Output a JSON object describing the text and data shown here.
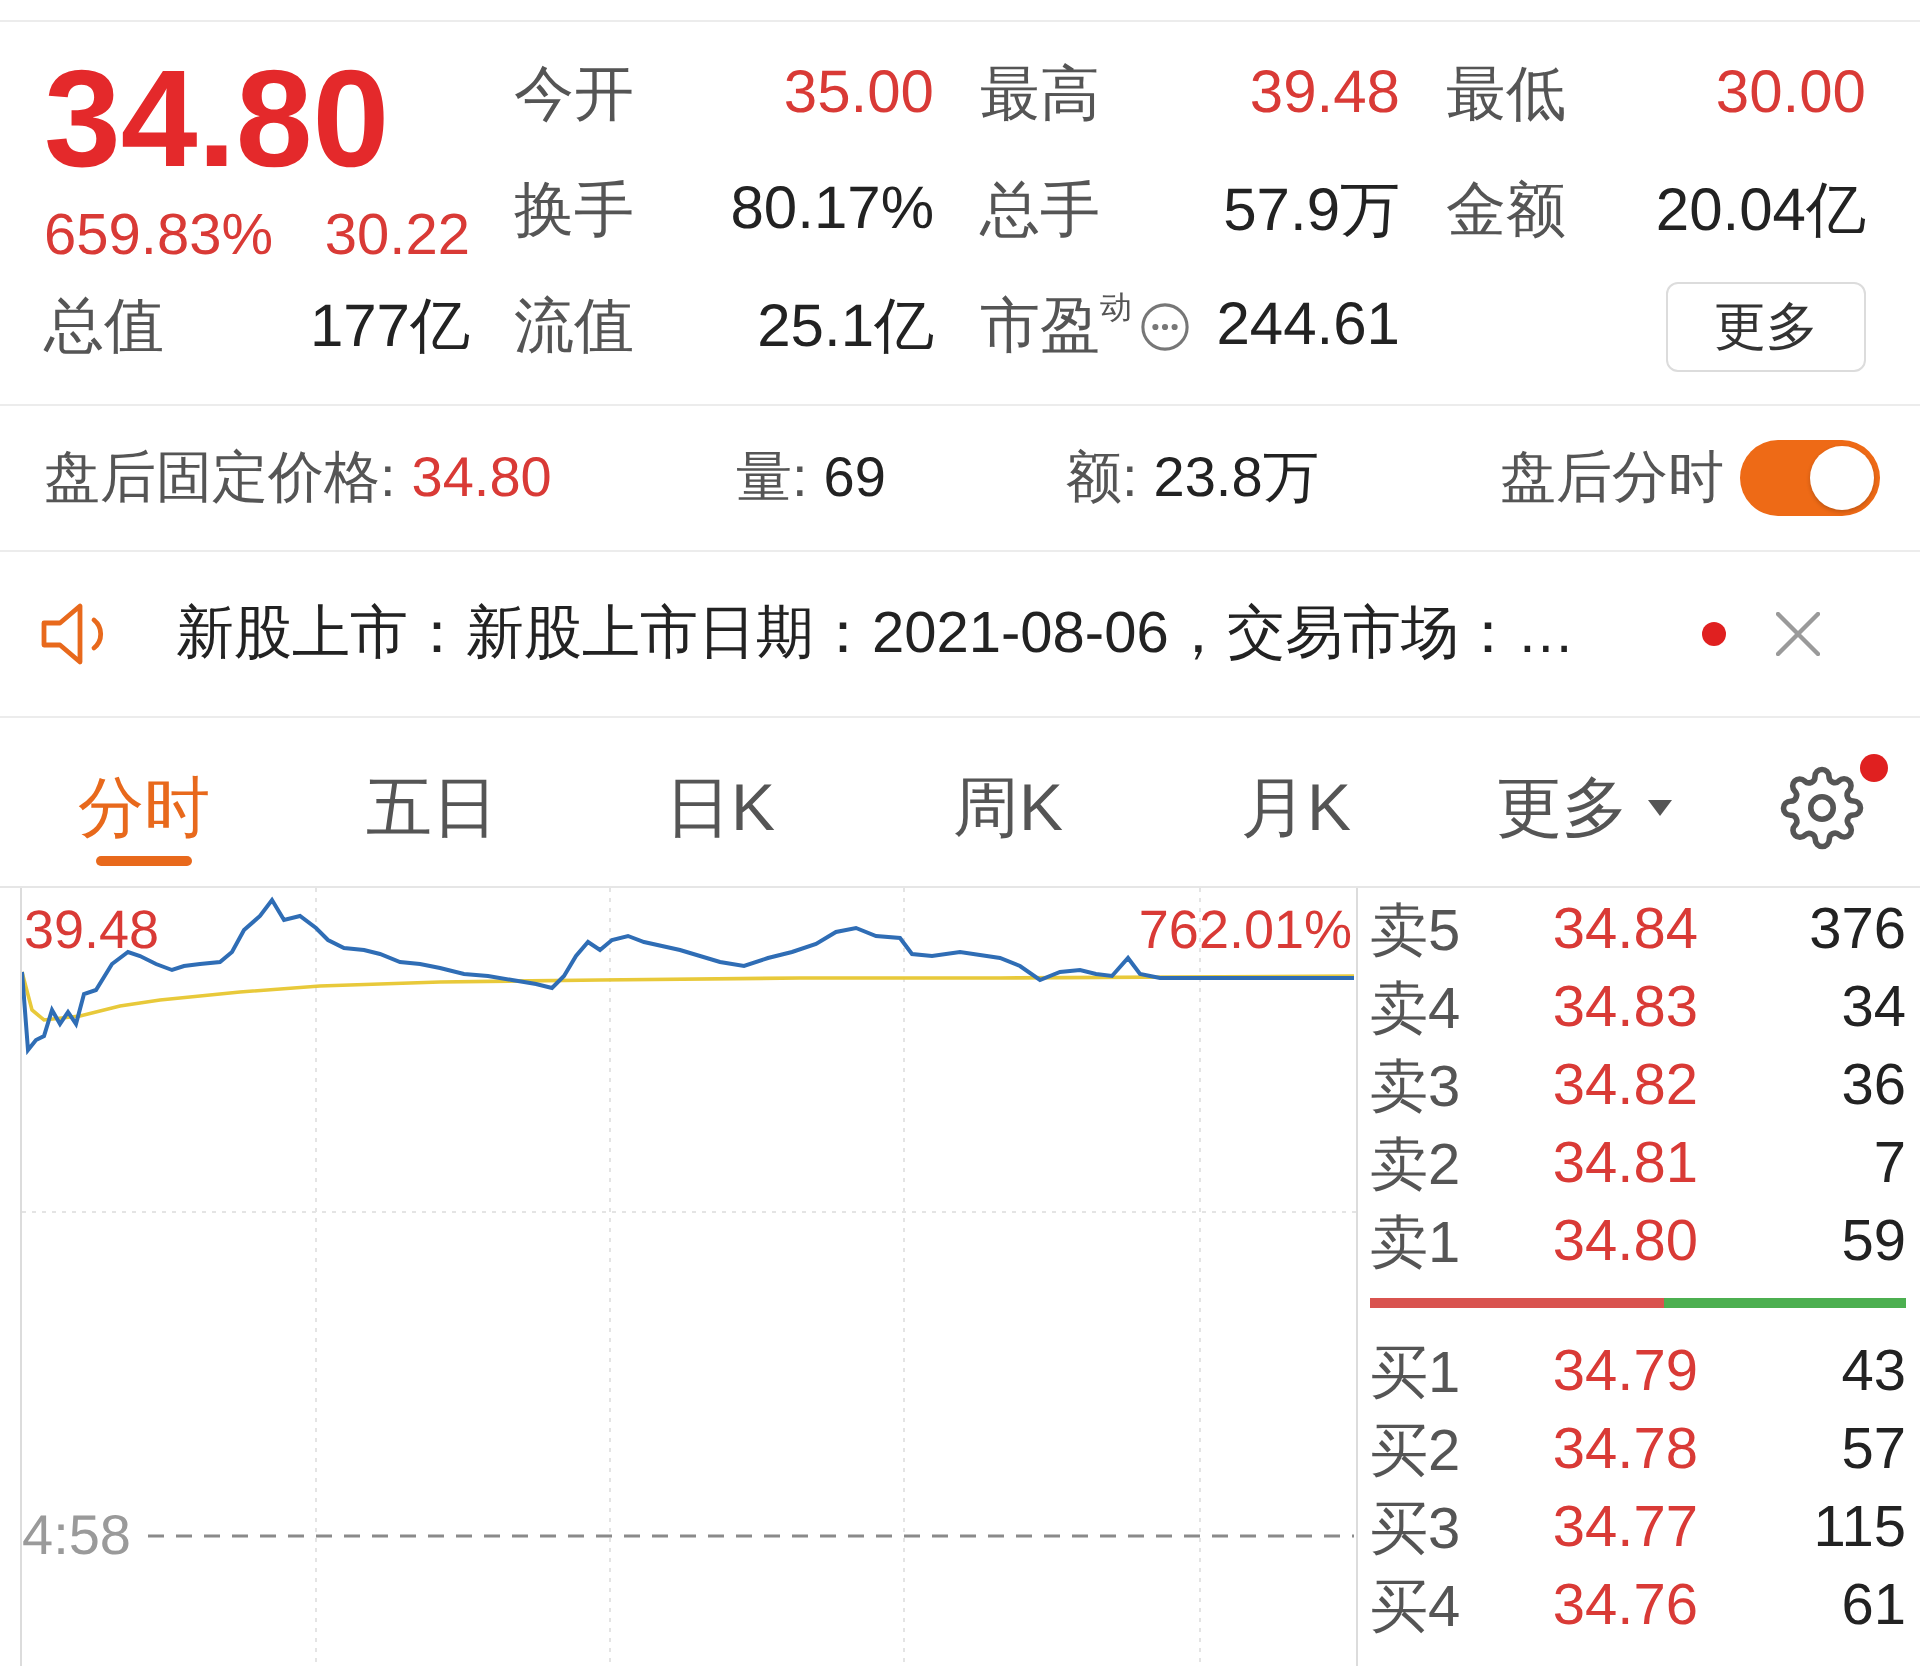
{
  "quote": {
    "price": "34.80",
    "change_pct": "659.83%",
    "change": "30.22",
    "total_label": "总值",
    "total_value": "177亿"
  },
  "stats": [
    {
      "label": "今开",
      "value": "35.00",
      "color": "#d93a36",
      "kind": "plain"
    },
    {
      "label": "最高",
      "value": "39.48",
      "color": "#d93a36",
      "kind": "plain"
    },
    {
      "label": "最低",
      "value": "30.00",
      "color": "#d93a36",
      "kind": "plain"
    },
    {
      "label": "换手",
      "value": "80.17%",
      "color": "#222222",
      "kind": "plain"
    },
    {
      "label": "总手",
      "value": "57.9万",
      "color": "#222222",
      "kind": "plain"
    },
    {
      "label": "金额",
      "value": "20.04亿",
      "color": "#222222",
      "kind": "plain"
    },
    {
      "label": "流值",
      "value": "25.1亿",
      "color": "#222222",
      "kind": "plain"
    },
    {
      "label": "市盈$^{动}$",
      "value": "244.61",
      "color": "#222222",
      "kind": "info"
    }
  ],
  "more_button": "更多",
  "after_hours": {
    "price_label": "盘后固定价格:",
    "price": "34.80",
    "volume_label": "量:",
    "volume": "69",
    "amount_label": "额:",
    "amount": "23.8万",
    "toggle_label": "盘后分时",
    "toggle_on": true
  },
  "notice": {
    "text": "新股上市：新股上市日期：2021-08-06，交易市场：…",
    "unread": true
  },
  "tabs": [
    {
      "label": "分时",
      "selected": true,
      "kind": "tab"
    },
    {
      "label": "五日",
      "selected": false,
      "kind": "tab"
    },
    {
      "label": "日K",
      "selected": false,
      "kind": "tab"
    },
    {
      "label": "周K",
      "selected": false,
      "kind": "tab"
    },
    {
      "label": "月K",
      "selected": false,
      "kind": "tab"
    },
    {
      "label": "更多",
      "selected": false,
      "kind": "dropdown"
    }
  ],
  "settings": {
    "badge": true
  },
  "chart": {
    "high_label": "39.48",
    "change_label": "762.01%",
    "cursor_label": "4:58"
  },
  "order_book": {
    "asks": [
      {
        "label": "卖5",
        "price": "34.84",
        "volume": "376"
      },
      {
        "label": "卖4",
        "price": "34.83",
        "volume": "34"
      },
      {
        "label": "卖3",
        "price": "34.82",
        "volume": "36"
      },
      {
        "label": "卖2",
        "price": "34.81",
        "volume": "7"
      },
      {
        "label": "卖1",
        "price": "34.80",
        "volume": "59"
      }
    ],
    "ratio": {
      "level": 0.55
    },
    "bids": [
      {
        "label": "买1",
        "price": "34.79",
        "volume": "43"
      },
      {
        "label": "买2",
        "price": "34.78",
        "volume": "57"
      },
      {
        "label": "买3",
        "price": "34.77",
        "volume": "115"
      },
      {
        "label": "买4",
        "price": "34.76",
        "volume": "61"
      }
    ]
  }
}
